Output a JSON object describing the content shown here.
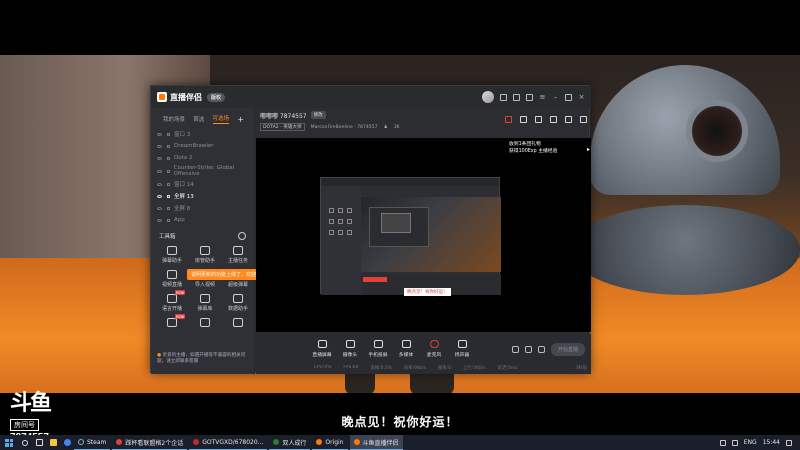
{
  "subtitle": "晚点见！祝你好运！",
  "watermark": {
    "logo": "斗鱼",
    "room_label": "房间号",
    "room_id": "7874557"
  },
  "app": {
    "brand": "直播伴侣",
    "version_pill": "版权",
    "sidebar": {
      "tabs": [
        "我的场景",
        "首选",
        "可选场"
      ],
      "scenes": [
        {
          "label": "窗口 3",
          "active": false
        },
        {
          "label": "DreamBrawler",
          "active": false
        },
        {
          "label": "Dota 2",
          "active": false
        },
        {
          "label": "Counter-Strike: Global Offensive",
          "active": false
        },
        {
          "label": "窗口 14",
          "active": false
        },
        {
          "label": "全屏 13",
          "active": true
        },
        {
          "label": "全屏 8",
          "active": false
        },
        {
          "label": "App",
          "active": false
        }
      ],
      "tools_title": "工具箱",
      "tools": [
        {
          "label": "弹幕助手",
          "badge": ""
        },
        {
          "label": "房管助手",
          "badge": ""
        },
        {
          "label": "主播任务",
          "badge": ""
        },
        {
          "label": "视频直播",
          "badge": ""
        },
        {
          "label": "导入视频",
          "badge": ""
        },
        {
          "label": "超级弹幕",
          "badge": ""
        },
        {
          "label": "语言开播",
          "badge": "new"
        },
        {
          "label": "弹幕库",
          "badge": ""
        },
        {
          "label": "数据助手",
          "badge": ""
        },
        {
          "label": "",
          "badge": "new"
        },
        {
          "label": "",
          "badge": ""
        },
        {
          "label": "",
          "badge": ""
        }
      ],
      "tooltip": "说明更新的功能上线了，欢迎来试用吧~",
      "notice": "亲爱的主播，如遇开播等不兼容的相关问题，请立即联系客服"
    },
    "main": {
      "room_title": "嘟嘟嘟 7874557",
      "edit_label": "修改",
      "game_tag": "DOTA2 - 英雄大师",
      "streamer": "MarconFireBeeline · 7874557",
      "viewers": "36",
      "gift_msg": "收到1条团礼物\n获得100Exp 主播经验",
      "preview_ad": "晚点见！祝你好运！",
      "controls": [
        "直播屏幕",
        "摄像头",
        "手机投屏",
        "多媒体",
        "麦克风",
        "扬声器"
      ],
      "start_label": "开始直播",
      "stats": [
        "CPU:0%",
        "FPS:60",
        "丢帧:0.0%",
        "码率:0kb/s",
        "帧率:0",
        "上行:0KB/s",
        "延迟:0ms",
        "0KB/s 上行",
        "3秒前"
      ]
    }
  },
  "taskbar": {
    "tasks": [
      {
        "label": "Steam",
        "color": "#1b2838"
      },
      {
        "label": "踩杯看联盟格2个企话",
        "color": "#e1413a"
      },
      {
        "label": "GOTVGXD/678020...",
        "color": "#c62828"
      },
      {
        "label": "双人成行",
        "color": "#2e7d32"
      },
      {
        "label": "Origin",
        "color": "#ff7a00"
      },
      {
        "label": "斗鱼直播伴侣",
        "color": "#ff7a00"
      }
    ],
    "lang": "ENG",
    "time": "15:44"
  }
}
